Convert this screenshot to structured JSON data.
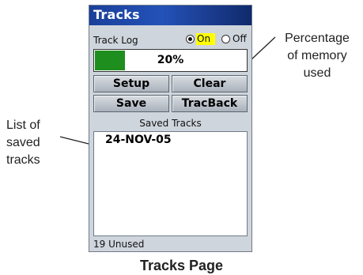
{
  "window": {
    "title": "Tracks"
  },
  "track_log": {
    "label": "Track Log",
    "on_label": "On",
    "off_label": "Off",
    "selected": "On"
  },
  "memory": {
    "percent_text": "20%",
    "fill_fraction": 0.2
  },
  "buttons": {
    "setup": "Setup",
    "clear": "Clear",
    "save": "Save",
    "tracback": "TracBack"
  },
  "saved_tracks": {
    "header": "Saved Tracks",
    "items": [
      "24-NOV-05"
    ],
    "unused_text": "19 Unused"
  },
  "callouts": {
    "percentage": [
      "Percentage",
      "of memory",
      "used"
    ],
    "list": [
      "List of",
      "saved",
      "tracks"
    ]
  },
  "caption": "Tracks Page",
  "colors": {
    "title_bar": "#2352b8",
    "memory_fill": "#1e8f1e",
    "on_highlight": "#ffff00"
  }
}
